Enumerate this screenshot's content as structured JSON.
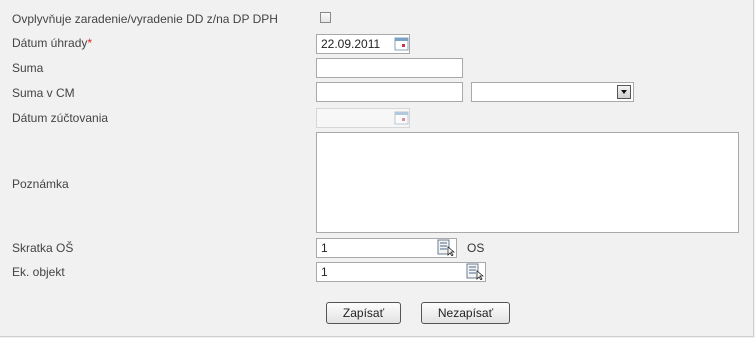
{
  "form": {
    "ovplyvnuje": {
      "label": "Ovplyvňuje zaradenie/vyradenie DD z/na DP DPH",
      "checked": false
    },
    "datum_uhrady": {
      "label": "Dátum úhrady",
      "required_mark": "*",
      "value": "22.09.2011"
    },
    "suma": {
      "label": "Suma",
      "value": ""
    },
    "suma_v_cm": {
      "label": "Suma v CM",
      "value": "",
      "currency_selected": ""
    },
    "datum_zuctovania": {
      "label": "Dátum zúčtovania",
      "value": ""
    },
    "poznamka": {
      "label": "Poznámka",
      "value": ""
    },
    "skratka_os": {
      "label": "Skratka OŠ",
      "value": "1",
      "unit": "OS"
    },
    "ek_objekt": {
      "label": "Ek. objekt",
      "value": "1"
    }
  },
  "buttons": {
    "save": "Zapísať",
    "cancel": "Nezapísať"
  },
  "icons": {
    "calendar": "calendar-icon",
    "lookup": "lookup-list-icon",
    "dropdown": "chevron-down-icon"
  },
  "colors": {
    "background": "#f1f1f1",
    "required": "#dd2222",
    "calendar_accent": "#cc3344"
  }
}
